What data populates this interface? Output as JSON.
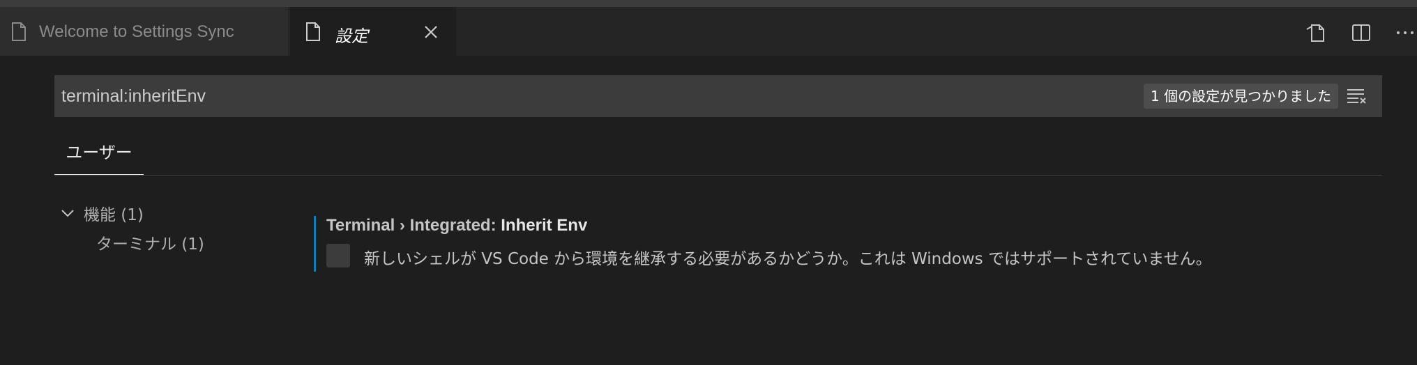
{
  "tabs": [
    {
      "label": "Welcome to Settings Sync",
      "active": false
    },
    {
      "label": "設定",
      "active": true
    }
  ],
  "toolbar_icons": [
    "open-settings-json-icon",
    "split-editor-icon",
    "more-actions-icon"
  ],
  "search": {
    "value": "terminal:inheritEnv",
    "result_count": "1 個の設定が見つかりました"
  },
  "scope_tab": "ユーザー",
  "toc": {
    "group": "機能 (1)",
    "item": "ターミナル (1)"
  },
  "setting": {
    "category": "Terminal › Integrated: ",
    "key": "Inherit Env",
    "description": "新しいシェルが VS Code から環境を継承する必要があるかどうか。これは Windows ではサポートされていません。",
    "checked": false
  },
  "colors": {
    "background": "#1e1e1e",
    "tabbar": "#252526",
    "modified_indicator": "#0e7fb3"
  }
}
